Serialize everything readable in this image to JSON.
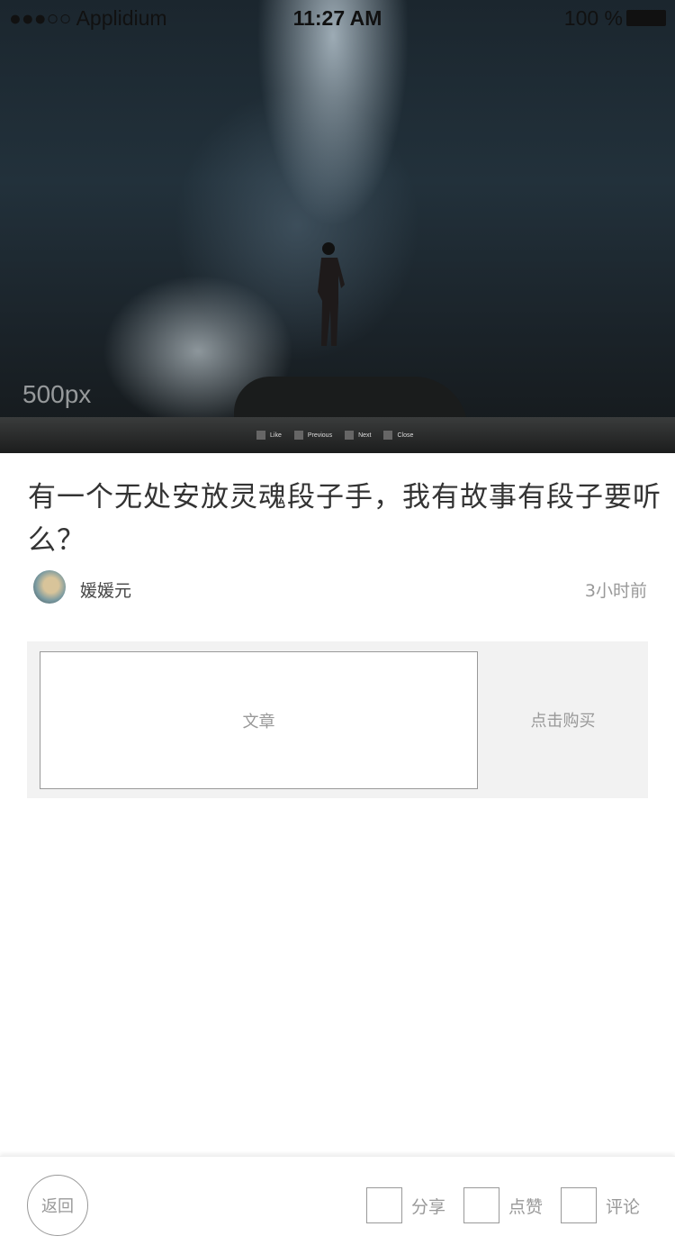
{
  "status_bar": {
    "carrier": "●●●○○ Applidium",
    "wifi_icon": "wifi-icon",
    "time": "11:27 AM",
    "battery": "100 %"
  },
  "hero": {
    "watermark": "500px",
    "controls": [
      "Like",
      "Previous",
      "Next",
      "Close"
    ]
  },
  "article": {
    "title": "有一个无处安放灵魂段子手，我有故事有段子要听么？",
    "author": "媛媛元",
    "time": "3小时前"
  },
  "card": {
    "article_label": "文章",
    "buy_label": "点击购买"
  },
  "bottom_bar": {
    "back": "返回",
    "share": "分享",
    "like": "点赞",
    "comment": "评论"
  }
}
